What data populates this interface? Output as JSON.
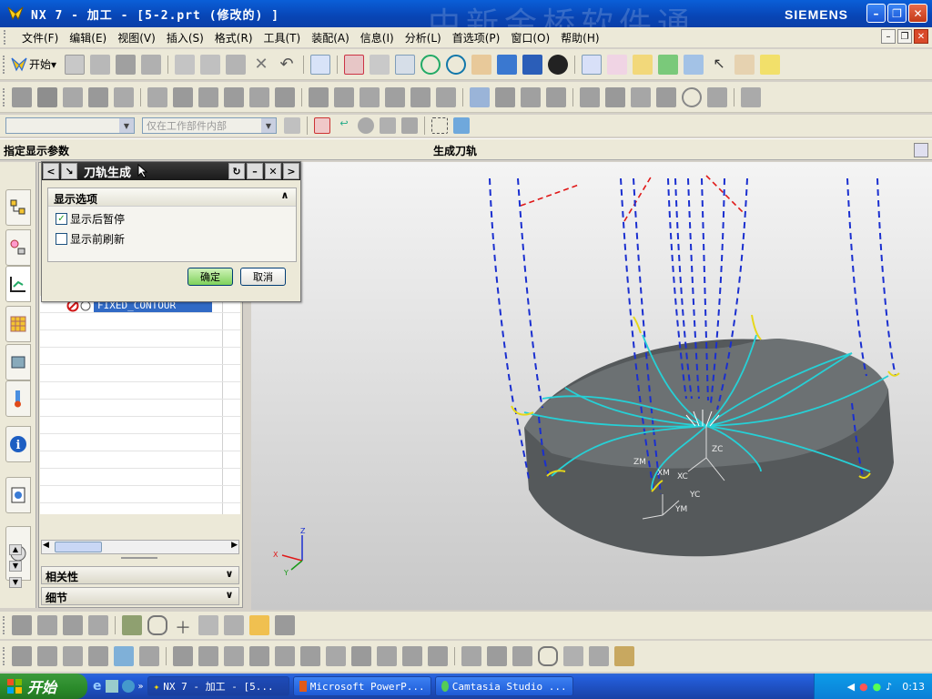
{
  "window": {
    "title": "NX 7 - 加工 - [5-2.prt (修改的) ]",
    "watermark": "中新金桥软件通",
    "brand": "SIEMENS"
  },
  "menubar": {
    "items": [
      "文件(F)",
      "编辑(E)",
      "视图(V)",
      "插入(S)",
      "格式(R)",
      "工具(T)",
      "装配(A)",
      "信息(I)",
      "分析(L)",
      "首选项(P)",
      "窗口(O)",
      "帮助(H)"
    ]
  },
  "toolbar": {
    "start_label": "开始"
  },
  "selection_bar": {
    "filter_value": "",
    "scope_value": "仅在工作部件内部"
  },
  "cue_line": {
    "cue": "指定显示参数",
    "status": "生成刀轨"
  },
  "navigator": {
    "operation_label": "FIXED_CONTOUR",
    "sections": [
      "相关性",
      "细节"
    ]
  },
  "dialog": {
    "title": "刀轨生成",
    "group_title": "显示选项",
    "options": [
      {
        "label": "显示后暂停",
        "checked": true
      },
      {
        "label": "显示前刷新",
        "checked": false
      }
    ],
    "ok_label": "确定",
    "cancel_label": "取消"
  },
  "viewport": {
    "triad_labels": [
      "Z",
      "X",
      "Y"
    ],
    "csys_labels": [
      "ZC",
      "XC",
      "YC",
      "XM",
      "YM",
      "ZM"
    ]
  },
  "taskbar": {
    "start_label": "开始",
    "tasks": [
      "NX 7 - 加工 - [5...",
      "Microsoft PowerP...",
      "Camtasia Studio ..."
    ],
    "clock": "0:13"
  },
  "colors": {
    "toolpath_cut": "#1a2fd0",
    "toolpath_rapid": "#e01818",
    "toolpath_engage": "#e6d81a",
    "toolpath_contour": "#26d0d6",
    "part": "#5a5e60"
  }
}
